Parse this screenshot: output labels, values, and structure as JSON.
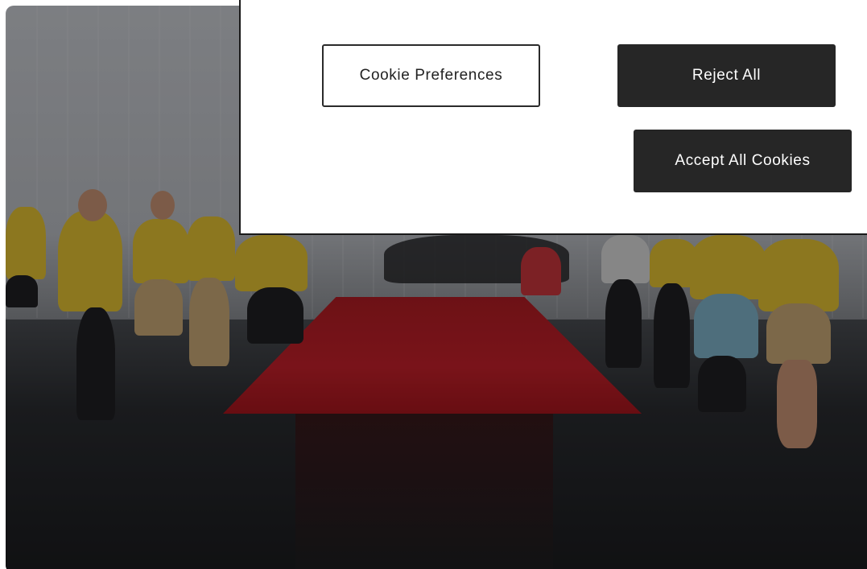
{
  "cookie_banner": {
    "preferences_label": "Cookie Preferences",
    "reject_label": "Reject All",
    "accept_label": "Accept All Cookies"
  },
  "colors": {
    "dark_button": "#262626",
    "carpet_red": "#c4202a",
    "volunteer_shirt": "#e3c033"
  }
}
